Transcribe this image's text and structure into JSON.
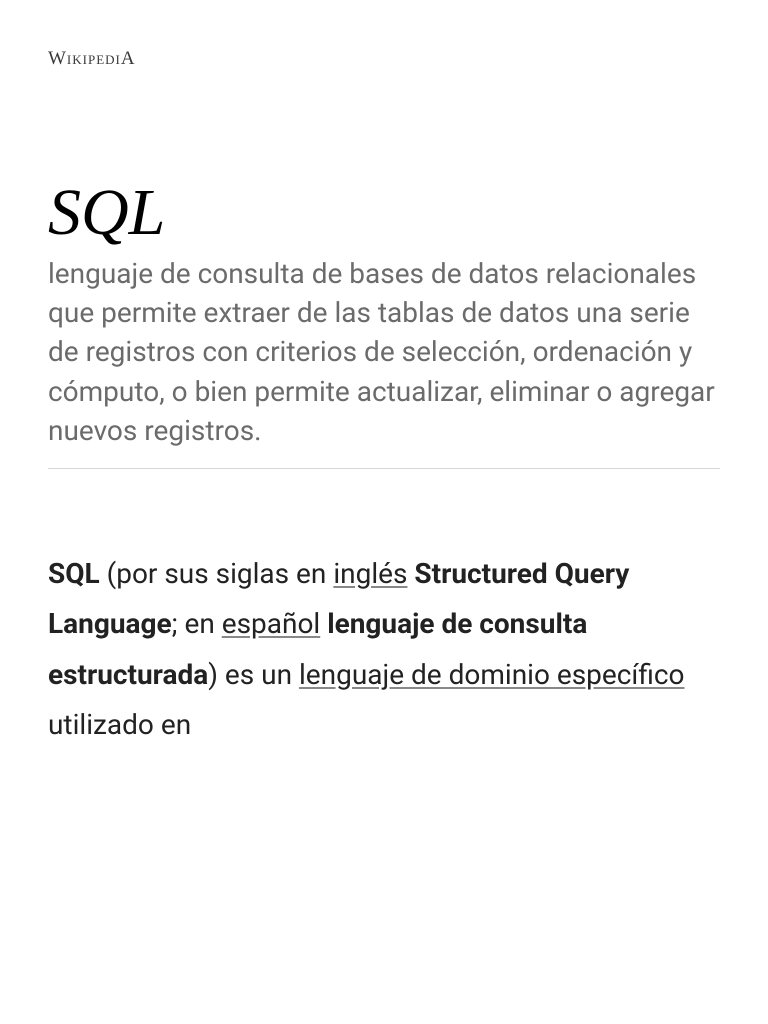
{
  "site": {
    "logo_text": "WikipediA"
  },
  "article": {
    "title": "SQL",
    "subtitle": "lenguaje de consulta de bases de datos relacionales que permite extraer de las tablas de datos una serie de registros con criterios de selección, ordenación y cómputo, o bien permite actualizar, eliminar o agregar nuevos registros.",
    "body": {
      "abbrev": "SQL",
      "text1": " (por sus siglas en ",
      "link1": "inglés",
      "bold1": " Structured Query Language",
      "text2": "; en ",
      "link2": "español",
      "bold2": " lenguaje de consulta estructurada",
      "text3": ") es un ",
      "link3": "lenguaje de dominio específico",
      "text4": " utilizado en"
    }
  }
}
